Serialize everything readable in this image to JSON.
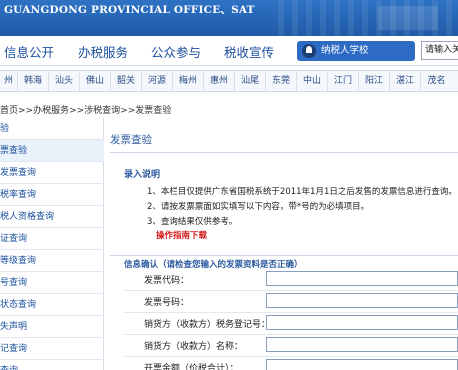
{
  "header": {
    "title": "GUANGDONG PROVINCIAL OFFICE、SAT",
    "accent": "#1f5aa8"
  },
  "nav": {
    "items": [
      "信息公开",
      "办税服务",
      "公众参与",
      "税收宣传"
    ],
    "school_button": "纳税人学校",
    "search_value": "请输入关"
  },
  "cities": [
    "州",
    "韩海",
    "汕头",
    "佛山",
    "韶关",
    "河源",
    "梅州",
    "惠州",
    "汕尾",
    "东莞",
    "中山",
    "江门",
    "阳江",
    "湛江",
    "茂名"
  ],
  "breadcrumb": "首页>>办税服务>>涉税查询>>发票查验",
  "sidebar": {
    "items": [
      "验",
      "票查验",
      "发票查询",
      "税率查询",
      "税人资格查询",
      "证查询",
      "等级查询",
      "号查询",
      "状态查询",
      "失声明",
      "记查询",
      "查询"
    ]
  },
  "content": {
    "title": "发票查验",
    "notes_heading": "录入说明",
    "notes": [
      "1、本栏目仅提供广东省国税系统于2011年1月1日之后发售的发票信息进行查询。",
      "2、请按发票票面如实填写以下内容，带*号的为必填项目。",
      "3、查询结果仅供参考。"
    ],
    "guide_link": "操作指南下载",
    "form_heading": "信息确认（请检查您输入的发票资料是否正确）",
    "fields": [
      {
        "label": "发票代码："
      },
      {
        "label": "发票号码："
      },
      {
        "label": "销货方（收款方）税务登记号："
      },
      {
        "label": "销货方（收款方）名称："
      },
      {
        "label": "开票金额（价税合计）："
      }
    ]
  }
}
